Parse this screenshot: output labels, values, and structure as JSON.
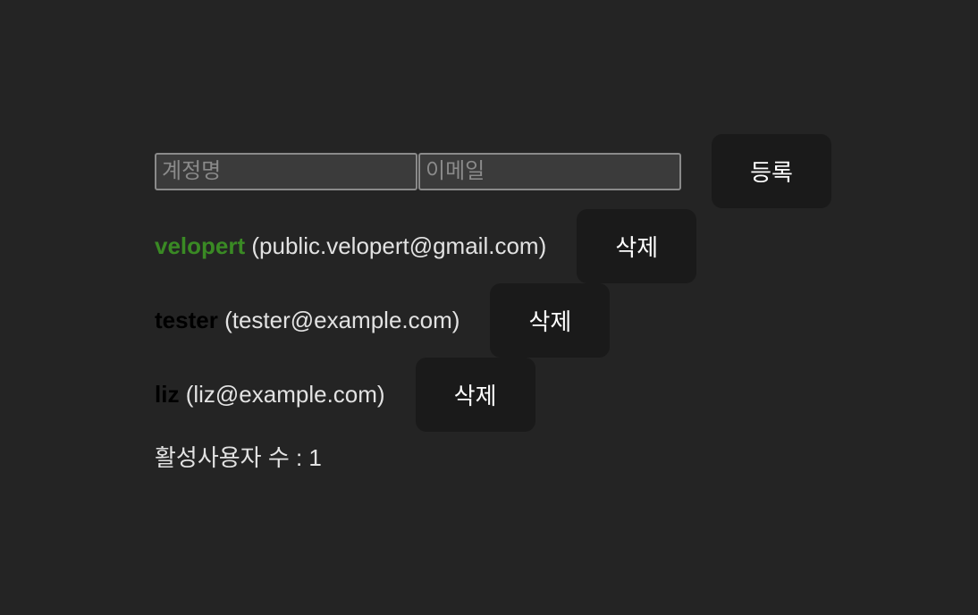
{
  "form": {
    "username_placeholder": "계정명",
    "email_placeholder": "이메일",
    "username_value": "",
    "email_value": "",
    "submit_label": "등록"
  },
  "users": [
    {
      "username": "velopert",
      "email": "(public.velopert@gmail.com)",
      "active": true,
      "delete_label": "삭제"
    },
    {
      "username": "tester",
      "email": "(tester@example.com)",
      "active": false,
      "delete_label": "삭제"
    },
    {
      "username": "liz",
      "email": "(liz@example.com)",
      "active": false,
      "delete_label": "삭제"
    }
  ],
  "colors": {
    "active": "#3a8a24",
    "inactive": "#000000"
  },
  "active_count_label": "활성사용자 수 : 1"
}
